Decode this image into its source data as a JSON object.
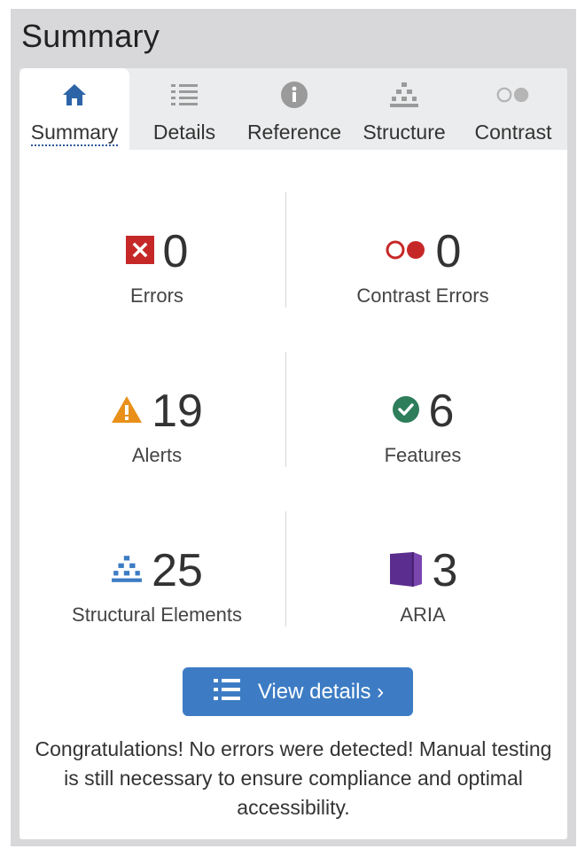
{
  "panel": {
    "title": "Summary"
  },
  "tabs": [
    {
      "label": "Summary",
      "icon": "home-icon",
      "active": true
    },
    {
      "label": "Details",
      "icon": "list-icon",
      "active": false
    },
    {
      "label": "Reference",
      "icon": "info-icon",
      "active": false
    },
    {
      "label": "Structure",
      "icon": "structure-icon",
      "active": false
    },
    {
      "label": "Contrast",
      "icon": "contrast-icon",
      "active": false
    }
  ],
  "stats": {
    "errors": {
      "count": "0",
      "label": "Errors",
      "icon": "error-icon",
      "color": "#c62828"
    },
    "contrast_errors": {
      "count": "0",
      "label": "Contrast Errors",
      "icon": "contrast-error-icon",
      "color": "#c62828"
    },
    "alerts": {
      "count": "19",
      "label": "Alerts",
      "icon": "alert-icon",
      "color": "#e8901a"
    },
    "features": {
      "count": "6",
      "label": "Features",
      "icon": "feature-check-icon",
      "color": "#2e7d5b"
    },
    "structural": {
      "count": "25",
      "label": "Structural Elements",
      "icon": "structure-icon",
      "color": "#3d7cc4"
    },
    "aria": {
      "count": "3",
      "label": "ARIA",
      "icon": "aria-icon",
      "color": "#5b2d8e"
    }
  },
  "button": {
    "label": "View details ›",
    "icon": "list-icon"
  },
  "message": "Congratulations! No errors were detected! Manual testing is still necessary to ensure compliance and optimal accessibility."
}
